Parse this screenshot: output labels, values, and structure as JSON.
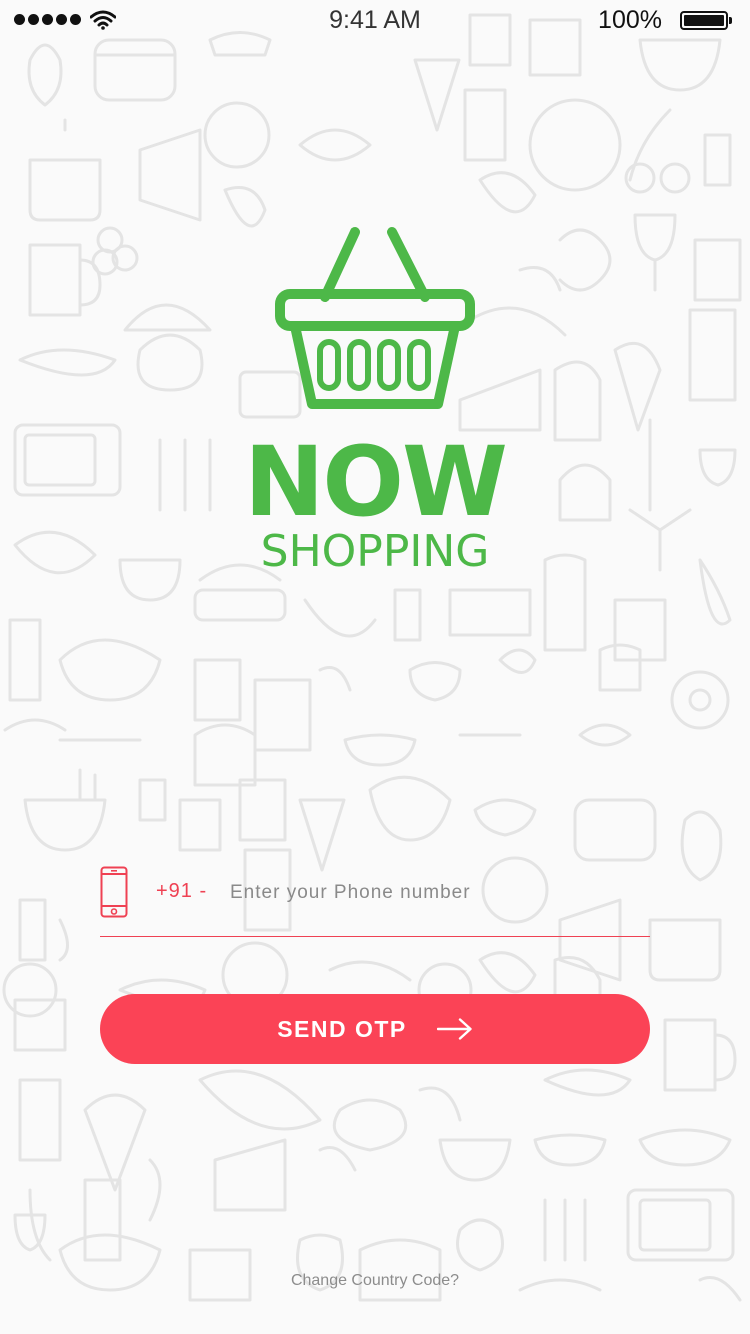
{
  "status_bar": {
    "time": "9:41 AM",
    "battery_percent": "100%",
    "icons": [
      "signal-icon",
      "wifi-icon",
      "battery-icon"
    ]
  },
  "brand": {
    "logo_icon": "shopping-basket-icon",
    "title": "NOW",
    "subtitle": "SHOPPING",
    "color": "#4db848"
  },
  "login": {
    "phone_icon": "mobile-phone-icon",
    "country_code": "+91 -",
    "phone_placeholder": "Enter your Phone number",
    "phone_value": "",
    "send_button_label": "SEND OTP",
    "send_button_icon": "arrow-right-icon",
    "change_country_link": "Change Country Code?",
    "accent_color": "#fb4356"
  }
}
